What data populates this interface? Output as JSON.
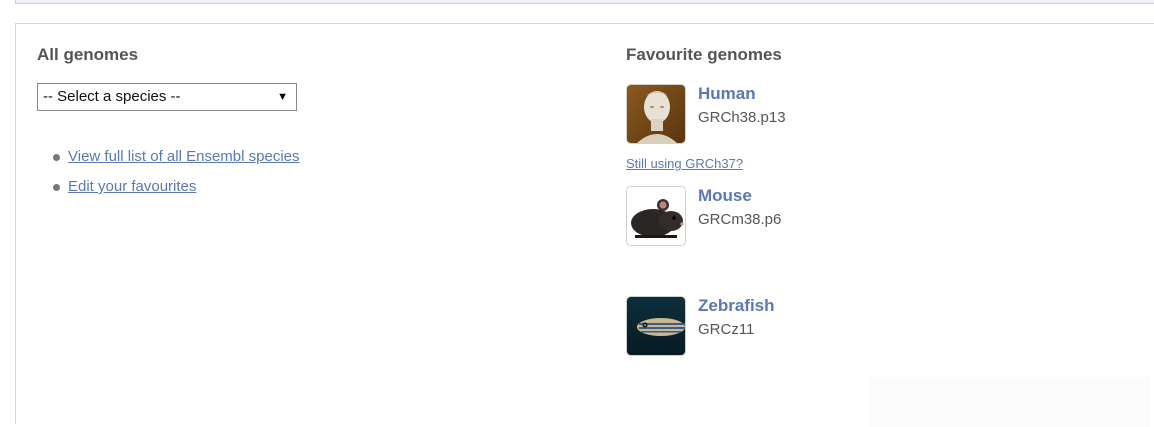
{
  "all_genomes": {
    "title": "All genomes",
    "select": {
      "selected": "-- Select a species --",
      "caret": "▼"
    },
    "links": [
      {
        "label": "View full list of all Ensembl species"
      },
      {
        "label": "Edit your favourites"
      }
    ]
  },
  "favourite_genomes": {
    "title": "Favourite genomes",
    "species": [
      {
        "name": "Human",
        "assembly": "GRCh38.p13",
        "icon": "human-statue-icon"
      },
      {
        "name": "Mouse",
        "assembly": "GRCm38.p6",
        "icon": "mouse-icon"
      },
      {
        "name": "Zebrafish",
        "assembly": "GRCz11",
        "icon": "zebrafish-icon"
      }
    ],
    "still_using_link": "Still using GRCh37?"
  },
  "colors": {
    "link": "#5a78b5",
    "heading": "#555555",
    "text": "#555555",
    "top_band": "#eef0f7"
  }
}
